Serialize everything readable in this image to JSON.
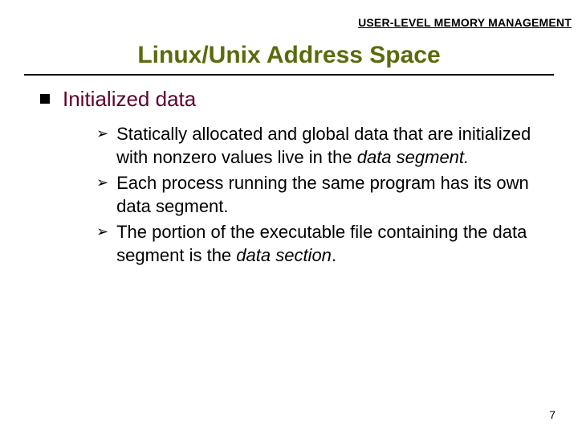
{
  "header": {
    "label": "USER-LEVEL MEMORY MANAGEMENT"
  },
  "title": "Linux/Unix Address Space",
  "section": {
    "heading": "Initialized data"
  },
  "bullets": [
    {
      "pre": "Statically allocated and global data that are initialized with nonzero values live in the ",
      "em": "data segment.",
      "post": ""
    },
    {
      "pre": "Each process running the same program has its own data segment.",
      "em": "",
      "post": ""
    },
    {
      "pre": "The portion of the executable file containing the data segment is the ",
      "em": "data section",
      "post": "."
    }
  ],
  "page_number": "7"
}
